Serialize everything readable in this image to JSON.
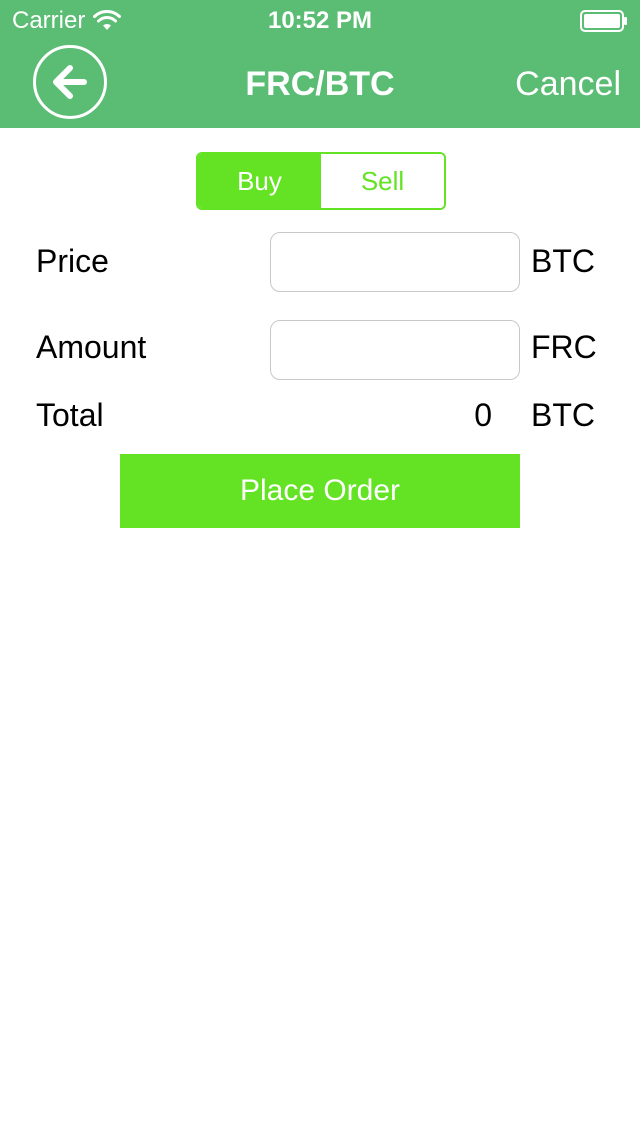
{
  "status_bar": {
    "carrier": "Carrier",
    "time": "10:52 PM",
    "wifi_icon": "wifi-icon",
    "battery_icon": "battery-icon"
  },
  "nav": {
    "title": "FRC/BTC",
    "cancel_label": "Cancel",
    "back_icon": "back-arrow-icon"
  },
  "segments": {
    "buy_label": "Buy",
    "sell_label": "Sell",
    "selected": "Buy"
  },
  "form": {
    "price_label": "Price",
    "price_unit": "BTC",
    "price_value": "",
    "amount_label": "Amount",
    "amount_unit": "FRC",
    "amount_value": "",
    "total_label": "Total",
    "total_value": "0",
    "total_unit": "BTC"
  },
  "actions": {
    "place_order_label": "Place Order"
  },
  "colors": {
    "header": "#5bbc74",
    "accent": "#63e323",
    "text": "#000000",
    "background": "#ffffff"
  }
}
